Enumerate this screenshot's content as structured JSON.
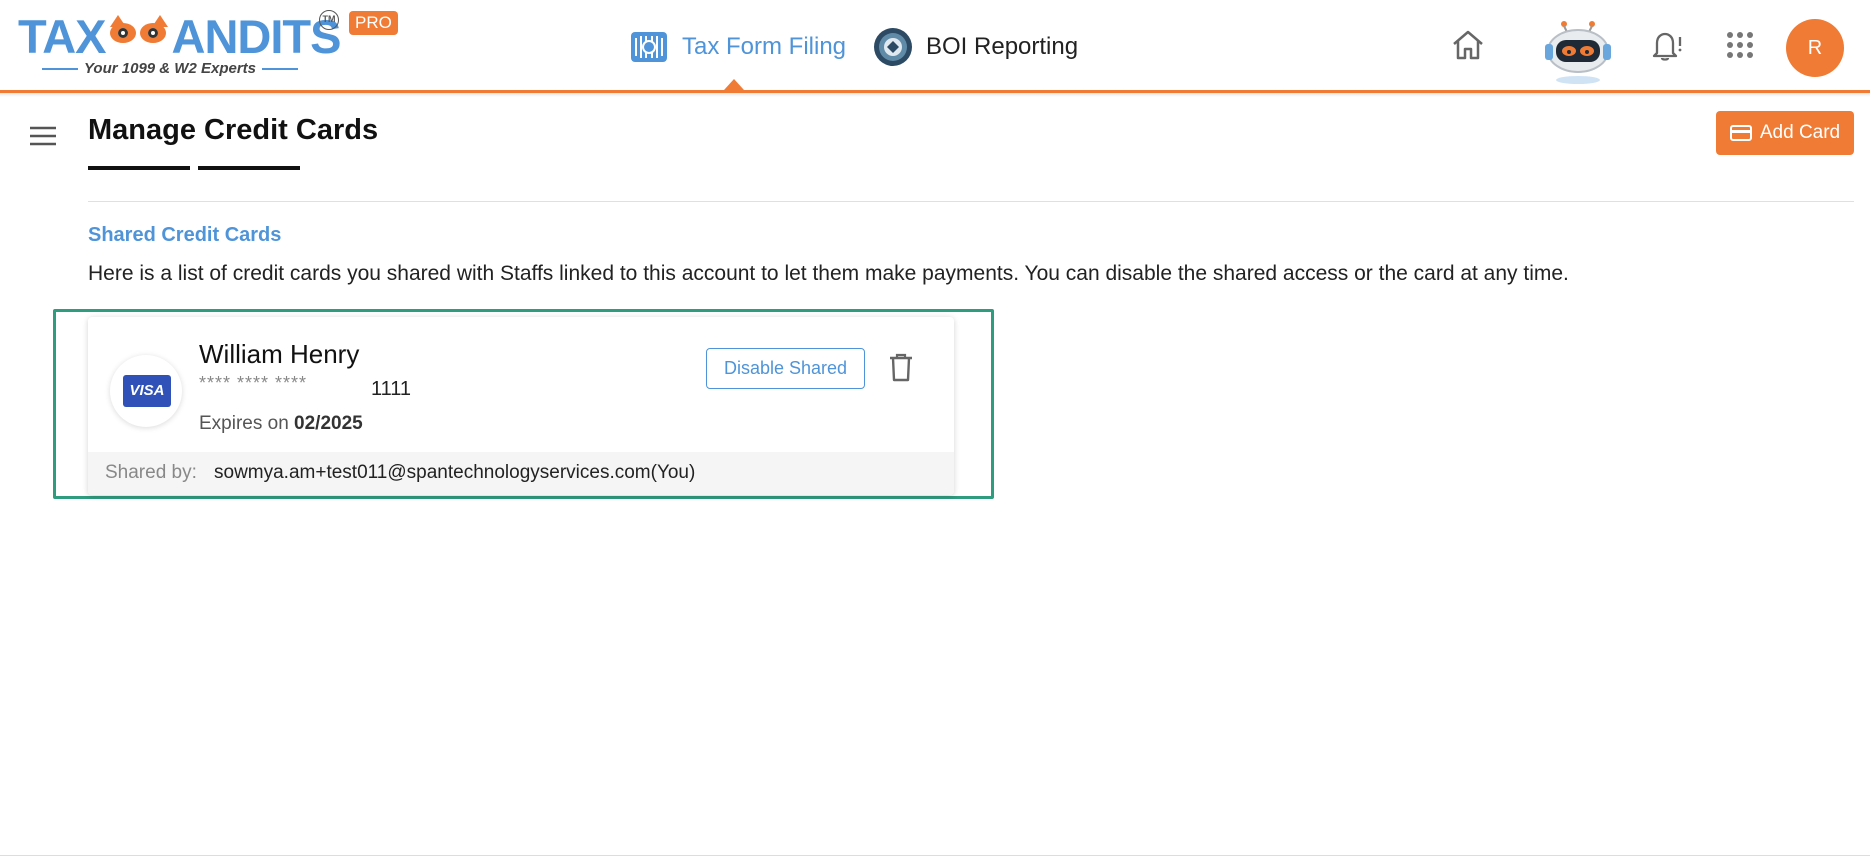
{
  "brand": {
    "word_left": "TAX",
    "word_right": "ANDITS",
    "tm": "TM",
    "pro": "PRO",
    "tagline": "Your 1099 & W2 Experts",
    "accent_color": "#f07b35",
    "blue_color": "#4f94d8"
  },
  "nav": {
    "irs_label": "Tax Form Filing",
    "irs_icon": "irs-eagle-icon",
    "boi_label": "BOI Reporting",
    "boi_icon": "boi-seal-icon"
  },
  "header_icons": {
    "home": "home-icon",
    "assistant": "robot-assistant-icon",
    "notifications": "bell-icon",
    "apps": "apps-grid-icon",
    "avatar_initial": "R"
  },
  "page": {
    "title": "Manage Credit Cards",
    "add_card_label": "Add Card",
    "section_title": "Shared Credit Cards",
    "section_desc": "Here is a list of credit cards you shared with Staffs linked to this account to let them make payments. You can disable the shared access or the card at any time."
  },
  "card": {
    "brand": "VISA",
    "holder": "William Henry",
    "masked": "**** **** ****",
    "last4": "1111",
    "expires_label": "Expires on ",
    "expires_value": "02/2025",
    "disable_label": "Disable Shared",
    "shared_by_label": "Shared by:",
    "shared_by_value": "sowmya.am+test011@spantechnologyservices.com(You)",
    "highlight_color": "#2f9b7f"
  }
}
